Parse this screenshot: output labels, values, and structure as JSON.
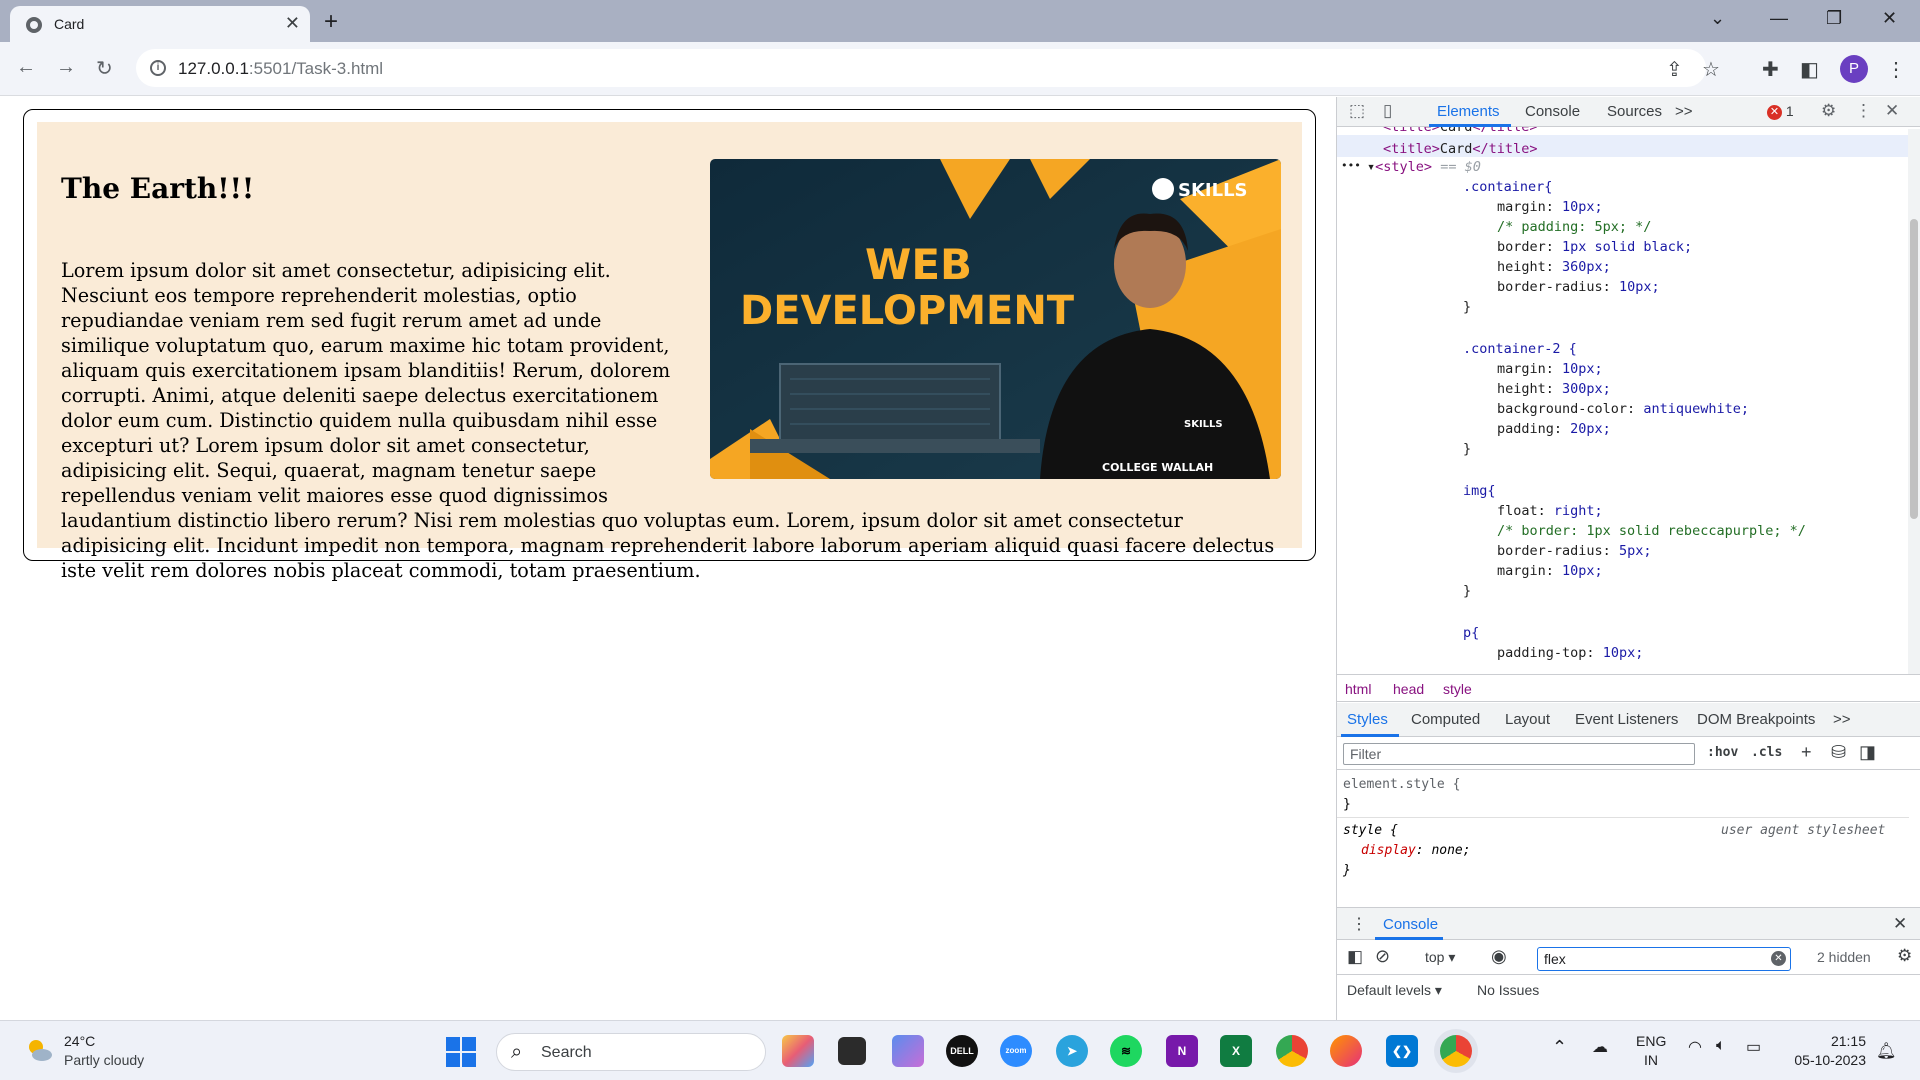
{
  "browser": {
    "tab_title": "Card",
    "tab_close": "✕",
    "new_tab": "+",
    "url_host": "127.0.0.1",
    "url_rest": ":5501/Task-3.html",
    "profile_initial": "P"
  },
  "page": {
    "heading": "The Earth!!!",
    "paragraph": "Lorem ipsum dolor sit amet consectetur, adipisicing elit. Nesciunt eos tempore reprehenderit molestias, optio repudiandae veniam rem sed fugit rerum amet ad unde similique voluptatum quo, earum maxime hic totam provident, aliquam quis exercitationem ipsam blanditiis! Rerum, dolorem corrupti. Animi, atque deleniti saepe delectus exercitationem dolor eum cum. Distinctio quidem nulla quibusdam nihil esse excepturi ut? Lorem ipsum dolor sit amet consectetur, adipisicing elit. Sequi, quaerat, magnam tenetur saepe repellendus veniam velit maiores esse quod dignissimos laudantium distinctio libero rerum? Nisi rem molestias quo voluptas eum. Lorem, ipsum dolor sit amet consectetur adipisicing elit. Incidunt impedit non tempora, magnam reprehenderit labore laborum aperiam aliquid quasi facere delectus iste velit rem dolores nobis placeat commodi, totam praesentium.",
    "image": {
      "line1": "WEB",
      "line2": "DEVELOPMENT",
      "brand": "SKILLS",
      "shirt_text": "COLLEGE WALLAH",
      "shirt_logo": "SKILLS"
    }
  },
  "devtools": {
    "tabs": [
      "Elements",
      "Console",
      "Sources"
    ],
    "more": ">>",
    "error_count": "1",
    "code": {
      "title_open": "<title>",
      "title_text": "Card",
      "title_close": "</title>",
      "style_tag": "<style>",
      "style_eq": "== $0",
      "ellipsis": "•••",
      "container_sel": ".container{",
      "container_margin": "10px;",
      "container_padding_comment": "/* padding: 5px; */",
      "container_border": "1px solid black;",
      "container_height": "360px;",
      "container_radius": "10px;",
      "container2_sel": ".container-2 {",
      "container2_margin": "10px;",
      "container2_height": "300px;",
      "container2_bg": "antiquewhite;",
      "container2_padding": "20px;",
      "img_sel": "img{",
      "img_float": "right;",
      "img_border_comment": "/* border: 1px solid rebeccapurple; */",
      "img_radius": "5px;",
      "img_margin": "10px;",
      "p_sel": "p{",
      "p_padding": "10px;",
      "close_brace": "}"
    },
    "prop_names": {
      "margin": "margin:",
      "border": "border:",
      "height": "height:",
      "radius": "border-radius:",
      "background": "background-color:",
      "padding": "padding:",
      "float": "float:",
      "padding_top": "padding-top:"
    },
    "breadcrumbs": [
      "html",
      "head",
      "style"
    ],
    "subtabs": [
      "Styles",
      "Computed",
      "Layout",
      "Event Listeners",
      "DOM Breakpoints"
    ],
    "filter_placeholder": "Filter",
    "hov": ":hov",
    "cls": ".cls",
    "rules": {
      "element_style": "element.style {",
      "close": "}",
      "style_sel": "style {",
      "ua_label": "user agent stylesheet",
      "display_prop": "display",
      "display_val": ": none;"
    },
    "console": {
      "title": "Console",
      "context": "top",
      "filter_value": "flex",
      "hidden": "2 hidden",
      "levels": "Default levels",
      "issues": "No Issues"
    }
  },
  "taskbar": {
    "temp": "24°C",
    "weather": "Partly cloudy",
    "search": "Search",
    "lang1": "ENG",
    "lang2": "IN",
    "time": "21:15",
    "date": "05-10-2023"
  }
}
